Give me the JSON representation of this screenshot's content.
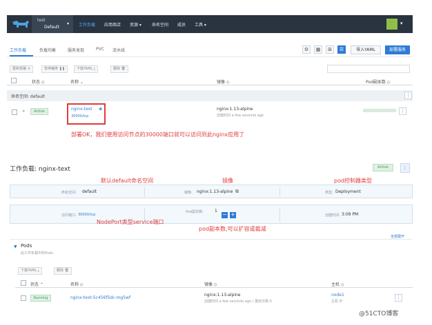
{
  "topbar": {
    "env_line1": "test",
    "env_line2": "Default",
    "nav": [
      "工作负载",
      "应用商店",
      "资源 ▾",
      "命名空间",
      "成员",
      "工具 ▾"
    ]
  },
  "tabs": [
    "工作负载",
    "负载均衡",
    "服务发现",
    "PVC",
    "流水线"
  ],
  "toolbar": {
    "import_label": "导入YAML",
    "deploy_label": "部署服务"
  },
  "actions": [
    "重新部署 ⟲",
    "暂停编排 ❚❚",
    "下载YAML ⤓",
    "删除 🗑"
  ],
  "table": {
    "headers": {
      "status": "状态 ◇",
      "name": "名称 ⌄",
      "image": "镜像 ◇",
      "pods": "Pod副本数 ◇"
    },
    "namespace_label": "命名空间: default",
    "row": {
      "status": "Active",
      "name": "nginx-text",
      "port": "30000/tcp",
      "image": "nginx:1.13-alpine",
      "image_sub": "创建时间 a few seconds ago"
    }
  },
  "annotations": {
    "a1": "部署OK，我们使用访问节点的30000端口就可以访问到此nginx应用了",
    "a2": "默认default命名空间",
    "a3": "镜像",
    "a4": "pod控制器类型",
    "a5": "NodePort类型service端口",
    "a6": "pod副本数,可以扩容或裁减"
  },
  "detail": {
    "title": "工作负载: nginx-text",
    "status": "Active",
    "ns_label": "命名空间:",
    "ns_value": "default",
    "image_label": "镜像:",
    "image_value": "nginx:1.13-alpine",
    "type_label": "类型:",
    "type_value": "Deployment",
    "port_label": "访问端口:",
    "port_value": "30000/tcp",
    "scale_label": "Pod副本数:",
    "scale_value": "1",
    "created_label": "创建时间:",
    "created_value": "3:09 PM",
    "expand_all": "全部展开"
  },
  "pods": {
    "title": "Pods",
    "subtitle": "此工作负载中的Pods",
    "actions": [
      "下载YAML ⤓",
      "删除 🗑"
    ],
    "headers": {
      "status": "状态 ⌃",
      "name": "名称 ◇",
      "image": "镜像 ◇",
      "host": "主机 ◇"
    },
    "row": {
      "status": "Running",
      "name": "nginx-text-5c456f5dc-mg5wf",
      "image": "nginx:1.13-alpine",
      "image_sub": "创建时间 a few seconds ago / 重启次数:0",
      "host": "node1",
      "host_sub": "主机 IP"
    }
  },
  "watermark": "@51CTO博客",
  "colors": {
    "accent": "#2d7bd5",
    "topbar": "#2a3340",
    "annotation": "#e03b3b",
    "active_green": "#3c9b5a"
  }
}
